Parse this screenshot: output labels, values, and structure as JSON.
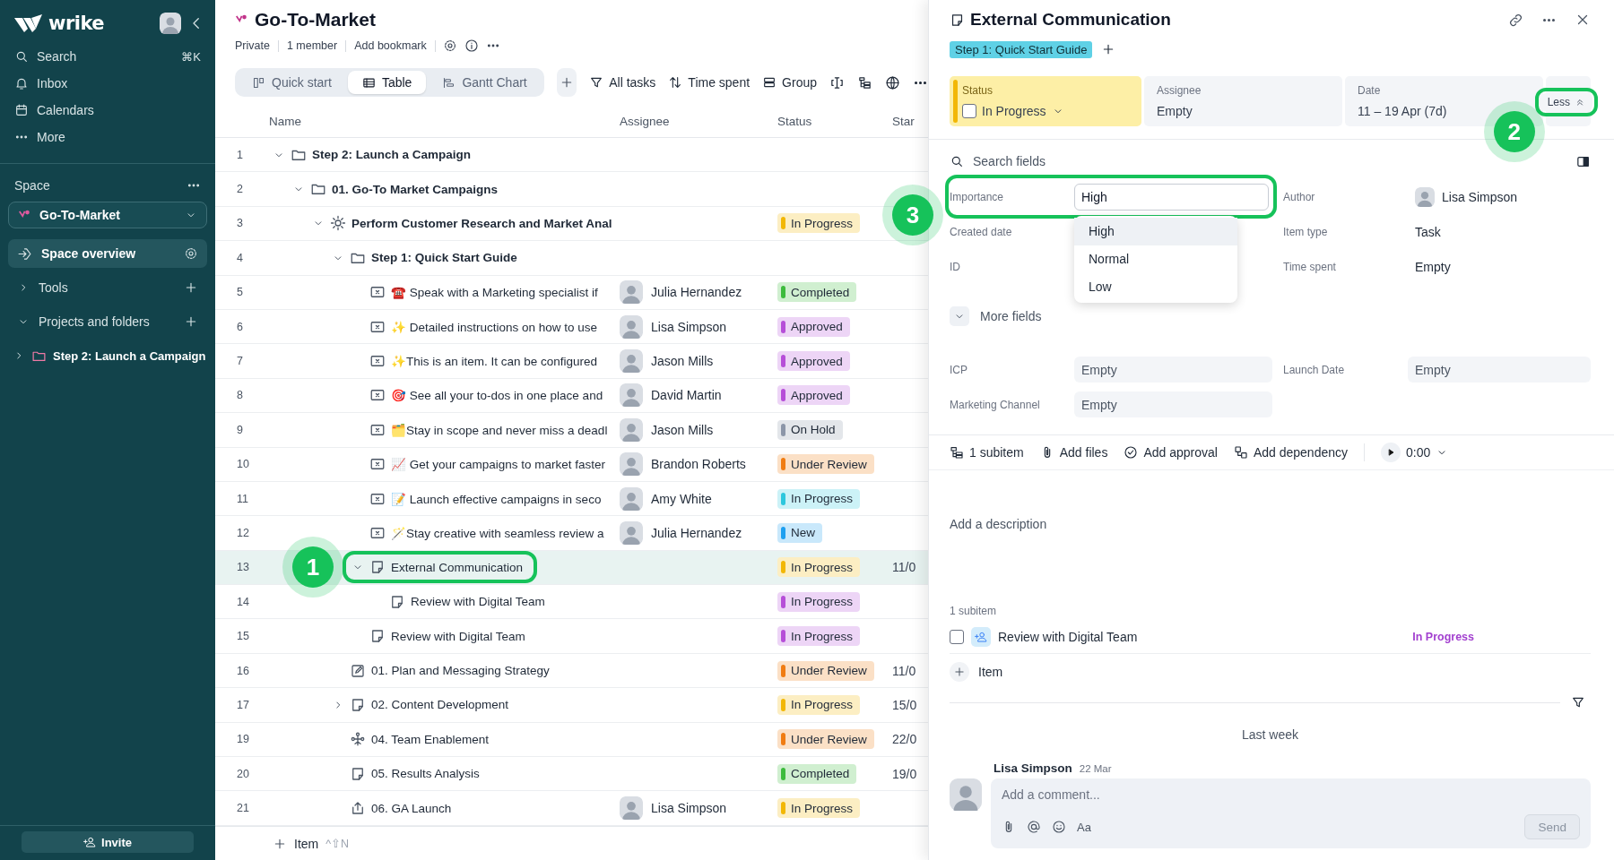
{
  "sidebar": {
    "logo": "wrike",
    "nav": [
      {
        "label": "Search",
        "shortcut": "⌘K"
      },
      {
        "label": "Inbox"
      },
      {
        "label": "Calendars"
      },
      {
        "label": "More"
      }
    ],
    "space_heading": "Space",
    "space_selector": "Go-To-Market",
    "items": [
      {
        "kind": "link",
        "label": "Space overview",
        "selected": true
      },
      {
        "kind": "section",
        "label": "Tools",
        "expanded": false,
        "selected": false
      },
      {
        "kind": "section",
        "label": "Projects and folders",
        "expanded": true,
        "selected": false,
        "children": [
          {
            "label": "Step 2: Launch a Campaign",
            "expanded": false,
            "selected": false
          }
        ]
      }
    ],
    "invite_button": "Invite"
  },
  "header": {
    "title": "Go-To-Market",
    "meta": [
      "Private",
      "1 member",
      "Add bookmark"
    ],
    "views": [
      {
        "label": "Quick start",
        "selected": false
      },
      {
        "label": "Table",
        "selected": true
      },
      {
        "label": "Gantt Chart",
        "selected": false
      }
    ],
    "toolbar": [
      "All tasks",
      "Time spent",
      "Group"
    ]
  },
  "table": {
    "columns": [
      "Name",
      "Assignee",
      "Status",
      "Star"
    ],
    "rows": [
      {
        "number": "1",
        "kind": "folder",
        "name": "Step 2: Launch a Campaign",
        "expanded": true,
        "selected": false,
        "children": [
          {
            "number": "2",
            "kind": "folder",
            "name": "01. Go-To Market Campaigns",
            "expanded": true,
            "selected": false,
            "children": [
              {
                "number": "3",
                "kind": "milestone",
                "name": "Perform Customer Research and Market Anal",
                "expanded": true,
                "selected": false,
                "status": "In Progress",
                "color": "#f2b705",
                "children": [
                  {
                    "number": "4",
                    "kind": "folder",
                    "name": "Step 1: Quick Start Guide",
                    "expanded": true,
                    "selected": false,
                    "children": [
                      {
                        "number": "5",
                        "kind": "item",
                        "name": "☎️ Speak with a Marketing specialist if",
                        "assignee": "Julia Hernandez",
                        "status": "Completed",
                        "color": "#3dbb3d",
                        "selected": false
                      },
                      {
                        "number": "6",
                        "kind": "item",
                        "name": "✨ Detailed instructions on how to use",
                        "assignee": "Lisa Simpson",
                        "status": "Approved",
                        "color": "#b64ed8",
                        "selected": false
                      },
                      {
                        "number": "7",
                        "kind": "item",
                        "name": "✨This is an item. It can be configured",
                        "assignee": "Jason Mills",
                        "status": "Approved",
                        "color": "#b64ed8",
                        "selected": false
                      },
                      {
                        "number": "8",
                        "kind": "item",
                        "name": "🎯 See all your to-dos in one place and",
                        "assignee": "David Martin",
                        "status": "Approved",
                        "color": "#b64ed8",
                        "selected": false
                      },
                      {
                        "number": "9",
                        "kind": "item",
                        "name": "🗂️Stay in scope and never miss a deadl",
                        "assignee": "Jason Mills",
                        "status": "On Hold",
                        "color": "#8c96a8",
                        "selected": false
                      },
                      {
                        "number": "10",
                        "kind": "item",
                        "name": "📈 Get your campaigns to market faster",
                        "assignee": "Brandon Roberts",
                        "status": "Under Review",
                        "color": "#f07c12",
                        "selected": false
                      },
                      {
                        "number": "11",
                        "kind": "item",
                        "name": "📝 Launch effective campaigns in seco",
                        "assignee": "Amy White",
                        "status": "In Progress",
                        "color": "#2cc7dd",
                        "selected": false
                      },
                      {
                        "number": "12",
                        "kind": "item",
                        "name": "🪄Stay creative with seamless review a",
                        "assignee": "Julia Hernandez",
                        "status": "New",
                        "color": "#1d9ff0",
                        "selected": false
                      },
                      {
                        "number": "13",
                        "kind": "task",
                        "name": "External Communication",
                        "expanded": true,
                        "selected": true,
                        "highlighted": true,
                        "callout": "1",
                        "status": "In Progress",
                        "color": "#f2b705",
                        "start": "11/0",
                        "children": [
                          {
                            "number": "14",
                            "kind": "task",
                            "name": "Review with Digital Team",
                            "status": "In Progress",
                            "color": "#b64ed8",
                            "selected": false
                          }
                        ]
                      },
                      {
                        "number": "15",
                        "kind": "task",
                        "name": "Review with Digital Team",
                        "status": "In Progress",
                        "color": "#b64ed8",
                        "selected": false
                      }
                    ]
                  },
                  {
                    "number": "16",
                    "kind": "plan",
                    "name": "01. Plan and Messaging Strategy",
                    "status": "Under Review",
                    "color": "#f07c12",
                    "start": "11/0",
                    "selected": false
                  },
                  {
                    "number": "17",
                    "kind": "task",
                    "name": "02. Content Development",
                    "expanded": false,
                    "status": "In Progress",
                    "color": "#f2b705",
                    "start": "15/0",
                    "selected": false
                  },
                  {
                    "number": "19",
                    "kind": "team",
                    "name": "04. Team Enablement",
                    "status": "Under Review",
                    "color": "#f07c12",
                    "start": "22/0",
                    "selected": false
                  },
                  {
                    "number": "20",
                    "kind": "task",
                    "name": "05. Results Analysis",
                    "status": "Completed",
                    "color": "#3dbb3d",
                    "start": "19/0",
                    "selected": false
                  },
                  {
                    "number": "21",
                    "kind": "release",
                    "name": "06. GA Launch",
                    "assignee": "Lisa Simpson",
                    "status": "In Progress",
                    "color": "#f2b705",
                    "selected": false
                  }
                ]
              }
            ]
          }
        ]
      }
    ],
    "add_item": "Item",
    "add_item_shortcut": "^⇧N"
  },
  "panel": {
    "title": "External Communication",
    "tags": [
      "Step 1: Quick Start Guide"
    ],
    "summary": [
      {
        "kind": "status",
        "label": "Status",
        "value": "In Progress",
        "checked": false,
        "color": "#f2b705"
      },
      {
        "kind": "plain",
        "label": "Assignee",
        "value": "Empty"
      },
      {
        "kind": "plain",
        "label": "Date",
        "value": "11 – 19 Apr (7d)"
      }
    ],
    "less_button": {
      "label": "Less",
      "highlighted": true,
      "callout": "2"
    },
    "search": {
      "placeholder": "Search fields"
    },
    "fields": [
      {
        "kind": "input",
        "label": "Importance",
        "value": "High",
        "highlighted": true,
        "callout": "3",
        "options": [
          {
            "label": "High",
            "selected": true
          },
          {
            "label": "Normal",
            "selected": false
          },
          {
            "label": "Low",
            "selected": false
          }
        ]
      },
      {
        "kind": "person",
        "label": "Author",
        "value": "Lisa Simpson"
      },
      {
        "kind": "plain",
        "label": "Created date"
      },
      {
        "kind": "plain",
        "label": "Item type",
        "value": "Task"
      },
      {
        "kind": "plain",
        "label": "ID"
      },
      {
        "kind": "plain",
        "label": "Time spent",
        "value": "Empty"
      }
    ],
    "more_fields": {
      "label": "More fields",
      "expanded": false
    },
    "custom_fields": [
      {
        "label": "ICP",
        "value": "Empty"
      },
      {
        "label": "Launch Date",
        "value": "Empty"
      },
      {
        "label": "Marketing Channel",
        "value": "Empty"
      }
    ],
    "actions": [
      "1 subitem",
      "Add files",
      "Add approval",
      "Add dependency"
    ],
    "timer": "0:00",
    "description": {
      "placeholder": "Add a description"
    },
    "subitems": {
      "heading": "1 subitem",
      "items": [
        {
          "name": "Review with Digital Team",
          "status": "In Progress",
          "color": "#a23fcf",
          "checked": false
        }
      ],
      "add_label": "Item"
    },
    "activity": {
      "group": "Last week",
      "comments": [
        {
          "author": "Lisa Simpson",
          "date": "22 Mar"
        }
      ],
      "composer": {
        "placeholder": "Add a comment...",
        "format_label": "Aa",
        "send": "Send",
        "send_disabled": true
      }
    }
  }
}
